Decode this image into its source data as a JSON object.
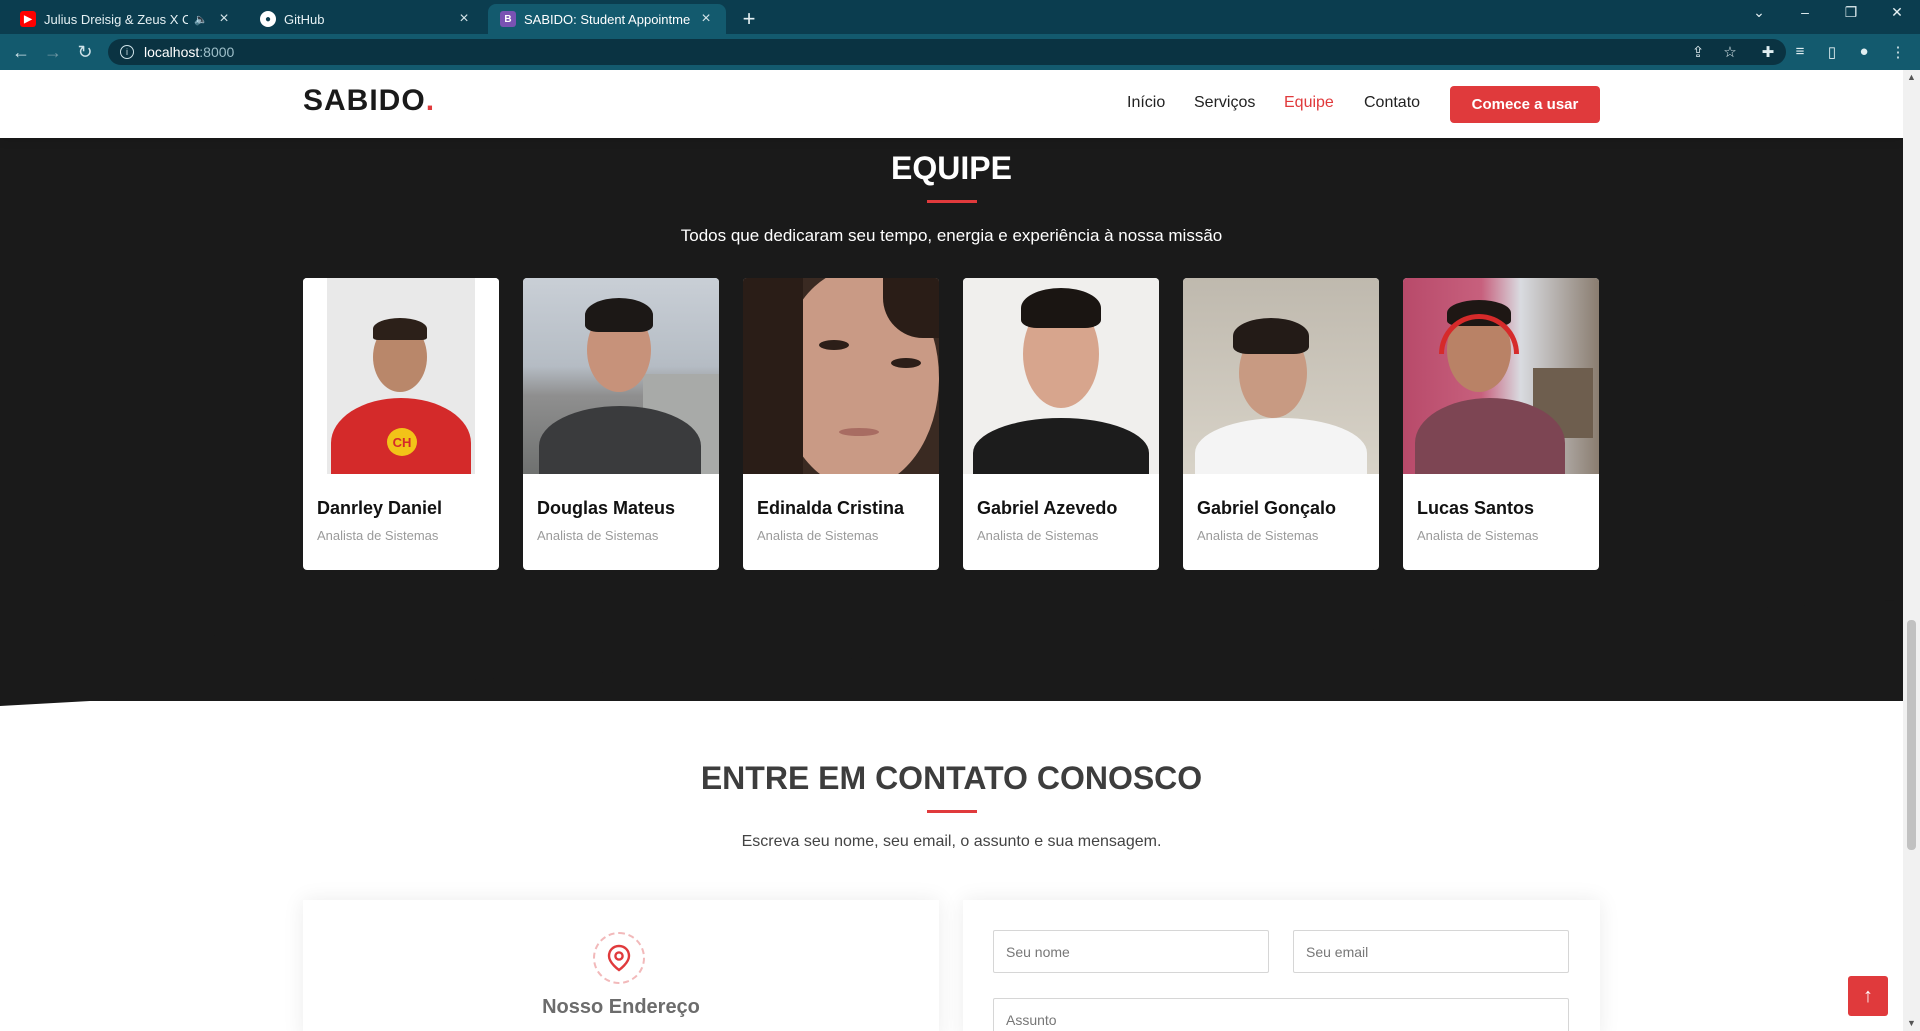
{
  "browser": {
    "tabs": [
      {
        "title": "Julius Dreisig & Zeus X Crona",
        "favicon": "youtube-icon"
      },
      {
        "title": "GitHub",
        "favicon": "github-icon"
      },
      {
        "title": "SABIDO: Student Appointment B",
        "favicon": "bootstrap-icon",
        "favicon_letter": "B"
      }
    ],
    "url_host": "localhost",
    "url_port": ":8000"
  },
  "header": {
    "logo": "SABIDO",
    "logo_dot": ".",
    "nav": [
      "Início",
      "Serviços",
      "Equipe",
      "Contato"
    ],
    "active_nav": "Equipe",
    "cta": "Comece a usar"
  },
  "team": {
    "title": "EQUIPE",
    "subtitle": "Todos que dedicaram seu tempo, energia e experiência à nossa missão",
    "members": [
      {
        "name": "Danrley Daniel",
        "role": "Analista de Sistemas"
      },
      {
        "name": "Douglas Mateus",
        "role": "Analista de Sistemas"
      },
      {
        "name": "Edinalda Cristina",
        "role": "Analista de Sistemas"
      },
      {
        "name": "Gabriel Azevedo",
        "role": "Analista de Sistemas"
      },
      {
        "name": "Gabriel Gonçalo",
        "role": "Analista de Sistemas"
      },
      {
        "name": "Lucas Santos",
        "role": "Analista de Sistemas"
      }
    ]
  },
  "contact": {
    "title": "ENTRE EM CONTATO CONOSCO",
    "subtitle": "Escreva seu nome, seu email, o assunto e sua mensagem.",
    "address_title": "Nosso Endereço",
    "form": {
      "name_placeholder": "Seu nome",
      "email_placeholder": "Seu email",
      "subject_placeholder": "Assunto"
    }
  },
  "colors": {
    "accent": "#e03a3c",
    "dark_section": "#1a1a1a",
    "browser_frame": "#0b3d4f"
  }
}
